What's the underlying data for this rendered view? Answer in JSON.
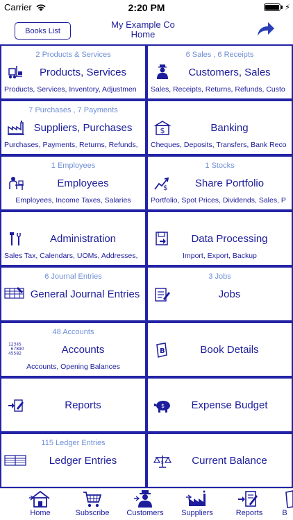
{
  "status": {
    "carrier": "Carrier",
    "time": "2:20 PM"
  },
  "nav": {
    "books_button": "Books List",
    "company": "My Example Co",
    "screen": "Home"
  },
  "tiles": [
    {
      "count": "2 Products & Services",
      "title": "Products, Services",
      "sub": "Products, Services, Inventory, Adjustmen",
      "icon": "forklift-icon"
    },
    {
      "count": "6 Sales , 6 Receipts",
      "title": "Customers, Sales",
      "sub": "Sales, Receipts, Returns, Refunds, Custo",
      "icon": "customer-icon"
    },
    {
      "count": "7 Purchases , 7 Payments",
      "title": "Suppliers, Purchases",
      "sub": "Purchases, Payments, Returns, Refunds,",
      "icon": "factory-icon"
    },
    {
      "count": "",
      "title": "Banking",
      "sub": "Cheques, Deposits, Transfers, Bank Reco",
      "icon": "bank-icon"
    },
    {
      "count": "1 Employees",
      "title": "Employees",
      "sub": "Employees, Income Taxes, Salaries",
      "icon": "employee-desk-icon"
    },
    {
      "count": "1 Stocks",
      "title": "Share Portfolio",
      "sub": "Portfolio, Spot Prices, Dividends, Sales, P",
      "icon": "stock-chart-icon"
    },
    {
      "count": "",
      "title": "Administration",
      "sub": "Sales Tax, Calendars, UOMs, Addresses,",
      "icon": "tools-icon"
    },
    {
      "count": "",
      "title": "Data Processing",
      "sub": "Import, Export, Backup",
      "icon": "disk-icon"
    },
    {
      "count": "6 Journal Entries",
      "title": "General Journal Entries",
      "sub": "",
      "icon": "ledger-grid-icon"
    },
    {
      "count": "3 Jobs",
      "title": "Jobs",
      "sub": "",
      "icon": "job-list-icon"
    },
    {
      "count": "48 Accounts",
      "title": "Accounts",
      "sub": "Accounts, Opening Balances",
      "icon": "account-numbers-icon"
    },
    {
      "count": "",
      "title": "Book Details",
      "sub": "",
      "icon": "book-icon"
    },
    {
      "count": "",
      "title": "Reports",
      "sub": "",
      "icon": "report-icon"
    },
    {
      "count": "",
      "title": "Expense Budget",
      "sub": "",
      "icon": "piggy-bank-icon"
    },
    {
      "count": "115 Ledger Entries",
      "title": "Ledger Entries",
      "sub": "",
      "icon": "ledger-icon"
    },
    {
      "count": "",
      "title": "Current Balance",
      "sub": "",
      "icon": "scales-icon"
    }
  ],
  "tabs": [
    {
      "label": "Home",
      "icon": "house-icon"
    },
    {
      "label": "Subscribe",
      "icon": "cart-icon"
    },
    {
      "label": "Customers",
      "icon": "customer-icon"
    },
    {
      "label": "Suppliers",
      "icon": "factory-icon"
    },
    {
      "label": "Reports",
      "icon": "report-icon"
    },
    {
      "label": "B",
      "icon": "book-icon"
    }
  ],
  "colors": {
    "accent": "#1c1c9c",
    "count_text": "#6f8fd6",
    "tile_border": "#2323a6"
  }
}
